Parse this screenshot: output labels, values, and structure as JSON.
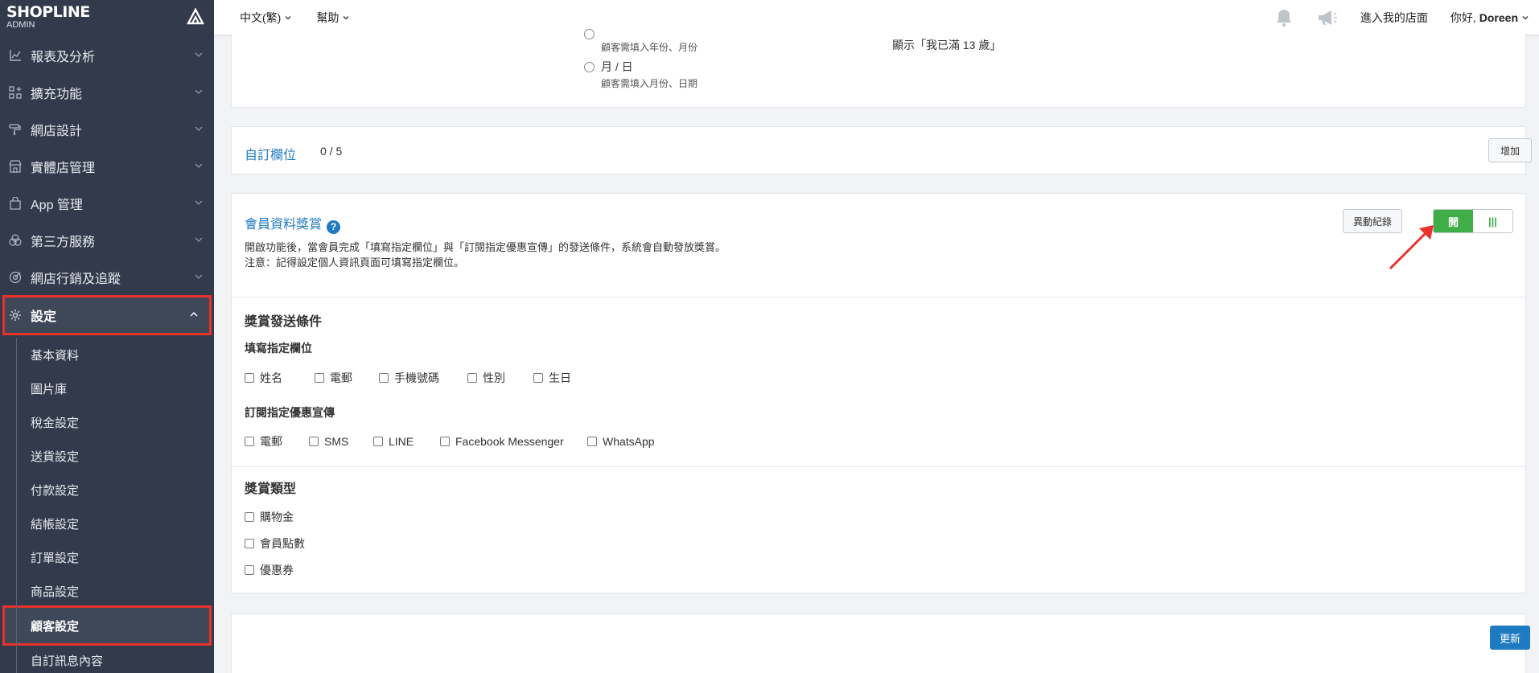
{
  "brand": {
    "logo": "SHOPLINE",
    "sub": "ADMIN"
  },
  "sidebar": {
    "items": [
      {
        "label": "報表及分析",
        "icon": "chart-icon"
      },
      {
        "label": "擴充功能",
        "icon": "apps-icon"
      },
      {
        "label": "網店設計",
        "icon": "paint-roller-icon"
      },
      {
        "label": "實體店管理",
        "icon": "store-icon"
      },
      {
        "label": "App 管理",
        "icon": "shopping-bag-icon"
      },
      {
        "label": "第三方服務",
        "icon": "circles-icon"
      },
      {
        "label": "網店行銷及追蹤",
        "icon": "target-icon"
      }
    ],
    "active": {
      "label": "設定",
      "icon": "gear-icon"
    },
    "submenu": [
      "基本資料",
      "圖片庫",
      "稅金設定",
      "送貨設定",
      "付款設定",
      "結帳設定",
      "訂單設定",
      "商品設定",
      "顧客設定",
      "自訂訊息內容"
    ],
    "selected_index": 8
  },
  "topbar": {
    "language": "中文(繁)",
    "help": "幫助",
    "store_link": "進入我的店面",
    "greeting_prefix": "你好, ",
    "user": "Doreen"
  },
  "birthday_card": {
    "year_month_hint": "顧客需填入年份、月份",
    "month_day_label": "月 / 日",
    "month_day_hint": "顧客需填入月份、日期",
    "age_text": "顯示「我已滿 13 歲」"
  },
  "custom_fields": {
    "title": "自訂欄位",
    "count": "0 / 5",
    "add_label": "增加"
  },
  "member_reward": {
    "title": "會員資料獎賞",
    "help": "?",
    "history_label": "異動紀錄",
    "toggle_on": "開",
    "toggle_off": "|||",
    "description": "開啟功能後，當會員完成「填寫指定欄位」與「訂閱指定優惠宣傳」的發送條件，系統會自動發放獎賞。",
    "note": "注意：記得設定個人資訊頁面可填寫指定欄位。",
    "conditions_title": "獎賞發送條件",
    "fields_title": "填寫指定欄位",
    "fields": [
      "姓名",
      "電郵",
      "手機號碼",
      "性別",
      "生日"
    ],
    "subscriptions_title": "訂閱指定優惠宣傳",
    "subscriptions": [
      "電郵",
      "SMS",
      "LINE",
      "Facebook Messenger",
      "WhatsApp"
    ],
    "reward_type_title": "獎賞類型",
    "reward_types": [
      "購物金",
      "會員點數",
      "優惠券"
    ]
  },
  "footer": {
    "update_label": "更新"
  },
  "colors": {
    "sidebar": "#323a4b",
    "accent": "#1f7bc1",
    "toggle_on": "#3fae49",
    "highlight": "#e8322a"
  }
}
